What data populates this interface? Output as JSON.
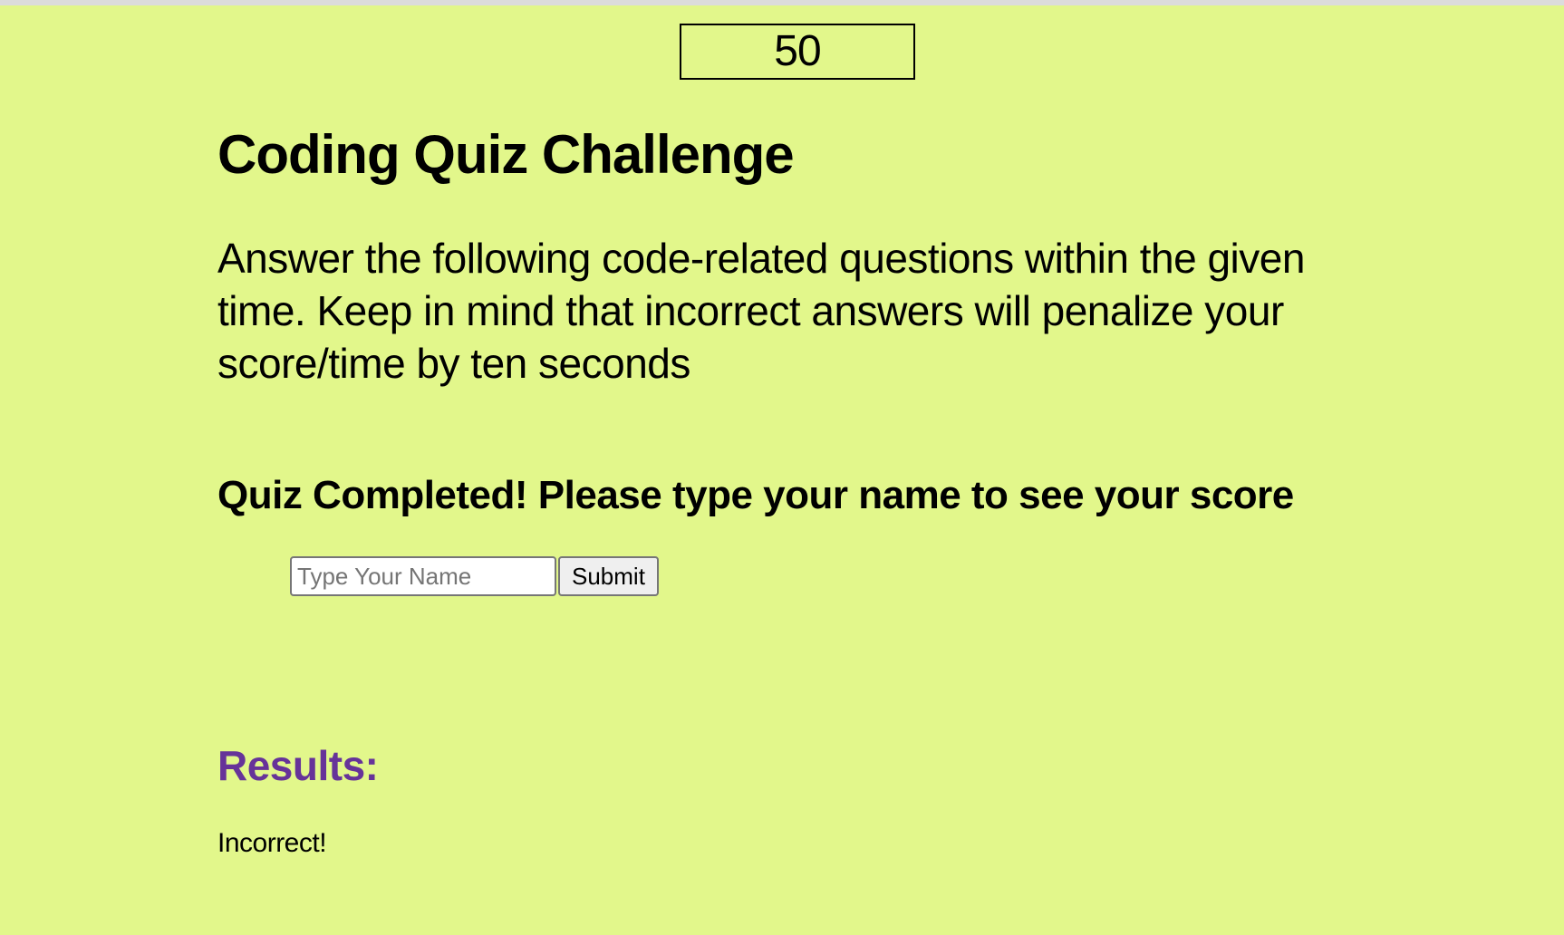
{
  "timer": {
    "value": "50"
  },
  "header": {
    "title": "Coding Quiz Challenge"
  },
  "instructions": {
    "text": "Answer the following code-related questions within the given time. Keep in mind that incorrect answers will penalize your score/time by ten seconds"
  },
  "completion": {
    "message": "Quiz Completed! Please type your name to see your score",
    "name_input": {
      "value": "",
      "placeholder": "Type Your Name"
    },
    "submit_label": "Submit"
  },
  "results": {
    "heading": "Results:",
    "feedback": "Incorrect!"
  },
  "colors": {
    "background": "#e2f78b",
    "results_heading": "#663399"
  }
}
